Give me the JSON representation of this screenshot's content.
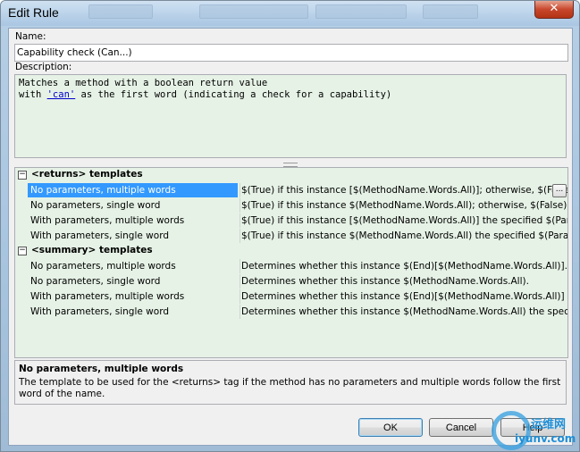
{
  "window": {
    "title": "Edit Rule",
    "close_glyph": "✕"
  },
  "name_field": {
    "label": "Name:",
    "value": "Capability check (Can...)"
  },
  "description": {
    "label": "Description:",
    "line1": "Matches a method with a boolean return value",
    "line2_prefix": "with ",
    "line2_link": "'can'",
    "line2_suffix": " as the first word (indicating a check for a capability)"
  },
  "templates_grid": {
    "returns_category": {
      "expander": "−",
      "label": "<returns> templates",
      "rows": [
        {
          "name": "No parameters, multiple words",
          "value": "$(True) if this instance [$(MethodName.Words.All)]; otherwise, $(False)."
        },
        {
          "name": "No parameters, single word",
          "value": "$(True) if this instance $(MethodName.Words.All); otherwise, $(False)."
        },
        {
          "name": "With parameters, multiple words",
          "value": "$(True) if this instance [$(MethodName.Words.All)] the specified $(Paramete"
        },
        {
          "name": "With parameters, single word",
          "value": "$(True) if this instance $(MethodName.Words.All) the specified $(Parameters"
        }
      ]
    },
    "summary_category": {
      "expander": "−",
      "label": "<summary> templates",
      "rows": [
        {
          "name": "No parameters, multiple words",
          "value": "Determines whether this instance $(End)[$(MethodName.Words.All)]."
        },
        {
          "name": "No parameters, single word",
          "value": "Determines whether this instance $(MethodName.Words.All)."
        },
        {
          "name": "With parameters, multiple words",
          "value": "Determines whether this instance $(End)[$(MethodName.Words.All)] the spe"
        },
        {
          "name": "With parameters, single word",
          "value": "Determines whether this instance $(MethodName.Words.All) the specified $("
        }
      ]
    },
    "ellipsis_label": "..."
  },
  "help_panel": {
    "title": "No parameters, multiple words",
    "description": "The template to be used for the <returns> tag if the method has no parameters and multiple words follow the first word of the name."
  },
  "buttons": {
    "ok": "OK",
    "cancel": "Cancel",
    "help": "Help"
  },
  "watermark": {
    "cn": "运维网",
    "en": "iyunv.com"
  },
  "colors": {
    "selection": "#3399ff",
    "grid_background": "#e6f2e6",
    "link": "#0000cc"
  }
}
